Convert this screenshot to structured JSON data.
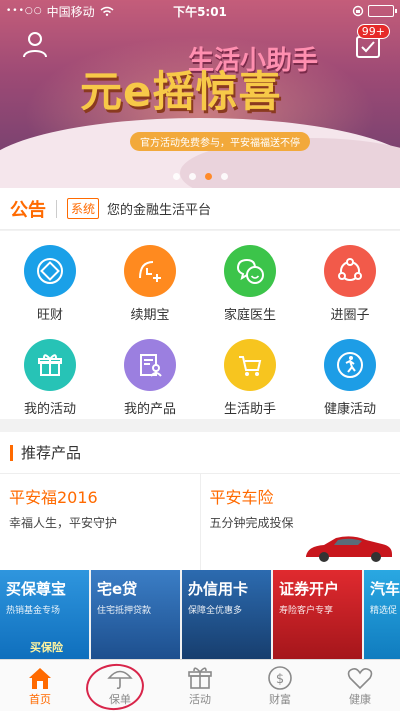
{
  "status": {
    "carrier": "中国移动",
    "time": "下午5:01",
    "battery_level": 1.0,
    "signal": "•••○○"
  },
  "banner": {
    "title_main": "元e摇惊喜",
    "title_sub": "生活小助手",
    "pill": "官方活动免费参与，平安福福送不停",
    "badge": "99+",
    "slides": 4,
    "active_slide": 3
  },
  "notice": {
    "title": "公告",
    "tag": "系统",
    "text": "您的金融生活平台"
  },
  "grid": [
    {
      "label": "旺财",
      "color": "#1aa0e8",
      "icon": "diamond-icon"
    },
    {
      "label": "续期宝",
      "color": "#ff8a1f",
      "icon": "clock-plus-icon"
    },
    {
      "label": "家庭医生",
      "color": "#3cc44a",
      "icon": "chat-smile-icon"
    },
    {
      "label": "进圈子",
      "color": "#f25a4a",
      "icon": "share-circle-icon"
    },
    {
      "label": "我的活动",
      "color": "#27c3b6",
      "icon": "gift-icon"
    },
    {
      "label": "我的产品",
      "color": "#9b7fe0",
      "icon": "document-person-icon"
    },
    {
      "label": "生活助手",
      "color": "#f7c51f",
      "icon": "cart-icon"
    },
    {
      "label": "健康活动",
      "color": "#1d9de6",
      "icon": "runner-icon"
    }
  ],
  "recommend": {
    "title": "推荐产品",
    "products": [
      {
        "name": "平安福2016",
        "desc": "幸福人生，平安守护"
      },
      {
        "name": "平安车险",
        "desc": "五分钟完成投保"
      }
    ]
  },
  "tiles": [
    {
      "title": "买保尊宝",
      "sub": "热销基金专场",
      "extra": "买保险",
      "color": "#1b88d8"
    },
    {
      "title": "宅e贷",
      "sub": "住宅抵押贷款",
      "extra": "",
      "color": "#2a6eb8"
    },
    {
      "title": "办信用卡",
      "sub": "保障全优惠多",
      "extra": "",
      "color": "#1f5f9e"
    },
    {
      "title": "证券开户",
      "sub": "寿险客户专享",
      "extra": "",
      "color": "#d8242a"
    },
    {
      "title": "汽车",
      "sub": "精选促",
      "extra": "",
      "color": "#1a9ad8"
    }
  ],
  "tabbar": [
    {
      "label": "首页",
      "icon": "home-icon",
      "active": true
    },
    {
      "label": "保单",
      "icon": "umbrella-icon",
      "active": false
    },
    {
      "label": "活动",
      "icon": "gift-icon",
      "active": false
    },
    {
      "label": "财富",
      "icon": "dollar-icon",
      "active": false
    },
    {
      "label": "健康",
      "icon": "heart-icon",
      "active": false
    }
  ]
}
